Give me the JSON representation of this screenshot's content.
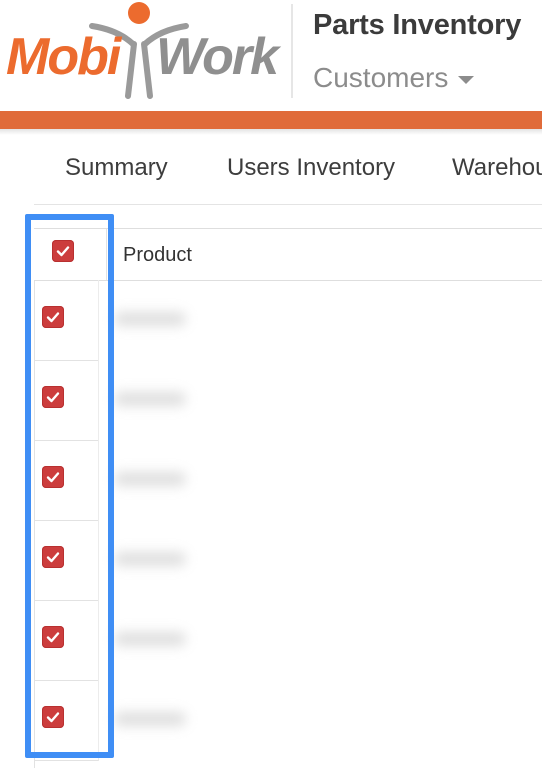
{
  "header": {
    "logo_text": "MobiWork",
    "title": "Parts Inventory",
    "dropdown_label": "Customers"
  },
  "colors": {
    "brand_orange": "#e06b3a",
    "logo_grey": "#8f8f8f",
    "checkbox_red": "#cc3d3d",
    "highlight_blue": "#3f8ef5"
  },
  "tabs": [
    {
      "label": "Summary"
    },
    {
      "label": "Users Inventory"
    },
    {
      "label": "Warehouse"
    }
  ],
  "table": {
    "columns": [
      "Product"
    ],
    "header_checkbox_checked": true,
    "rows": [
      {
        "checked": true
      },
      {
        "checked": true
      },
      {
        "checked": true
      },
      {
        "checked": true
      },
      {
        "checked": true
      },
      {
        "checked": true
      }
    ]
  },
  "icons": [
    "check-icon",
    "caret-down-icon"
  ]
}
